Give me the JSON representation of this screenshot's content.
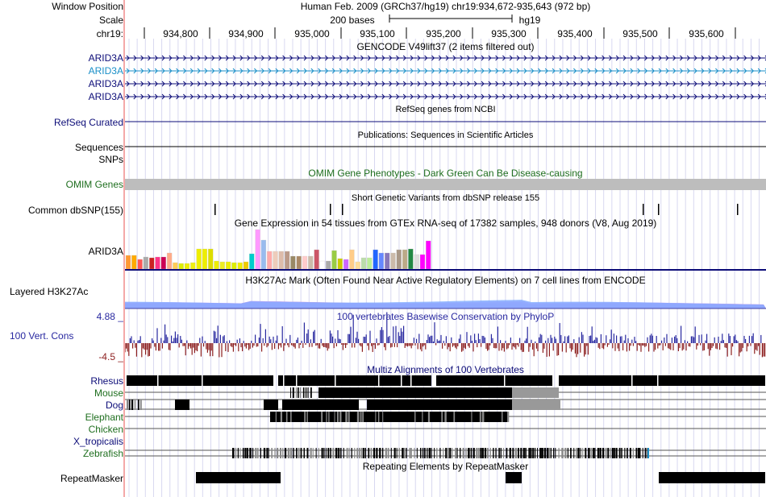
{
  "header": {
    "window_position_label": "Window Position",
    "window_position_value": "Human Feb. 2009 (GRCh37/hg19)   chr19:934,672-935,643 (972 bp)",
    "scale_label": "Scale",
    "scale_bar_text": "200 bases",
    "scale_assembly": "hg19",
    "chrom_label": "chr19:",
    "ruler_ticks": [
      "934,800",
      "934,900",
      "935,000",
      "935,100",
      "935,200",
      "935,300",
      "935,400",
      "935,500",
      "935,600"
    ]
  },
  "tracks": {
    "gencode": {
      "title": "GENCODE V49lift37 (2 items filtered out)",
      "items": [
        "ARID3A",
        "ARID3A",
        "ARID3A",
        "ARID3A"
      ],
      "color_primary": "#0c0c78",
      "color_secondary": "#1a8fc8"
    },
    "refseq": {
      "title": "RefSeq genes from NCBI",
      "label": "RefSeq Curated",
      "color": "#0c0c78"
    },
    "publications": {
      "title": "Publications: Sequences in Scientific Articles",
      "label": "Sequences"
    },
    "snps": {
      "label": "SNPs"
    },
    "omim": {
      "title": "OMIM Gene Phenotypes - Dark Green Can Be Disease-causing",
      "label": "OMIM Genes",
      "color": "#1e6e1e"
    },
    "dbsnp": {
      "title": "Short Genetic Variants from dbSNP release 155",
      "label": "Common dbSNP(155)"
    },
    "gtex": {
      "title": "Gene Expression in 54 tissues from GTEx RNA-seq of 17382 samples, 948 donors (V8, Aug 2019)",
      "label": "ARID3A",
      "values": [
        17,
        17,
        12,
        15,
        14,
        15,
        15,
        20,
        8,
        7,
        7,
        8,
        25,
        25,
        25,
        10,
        9,
        9,
        8,
        8,
        9,
        19,
        49,
        36,
        22,
        22,
        22,
        22,
        16,
        16,
        16,
        16,
        24,
        10,
        10,
        23,
        13,
        12,
        24,
        9,
        14,
        14,
        24,
        20,
        20,
        20,
        24,
        24,
        25,
        18,
        18,
        35
      ],
      "colors": [
        "#ff9933",
        "#ffaa00",
        "#ff5555",
        "#aaaaaa",
        "#cc2222",
        "#ff3388",
        "#cc0055",
        "#ffaa88",
        "#ffcc55",
        "#ddee00",
        "#eeee00",
        "#eeee11",
        "#eeee00",
        "#eeee00",
        "#dddd00",
        "#eeee00",
        "#eeee22",
        "#eeee00",
        "#ddee00",
        "#eeee00",
        "#eecc00",
        "#00cccc",
        "#ff99ff",
        "#99bbee",
        "#ffaaaa",
        "#eeccbb",
        "#ddbbaa",
        "#bb9988",
        "#998866",
        "#aa8866",
        "#ffcccc",
        "#ccbbaa",
        "#cc5566",
        "#ffffff",
        "#aaaaaa",
        "#99cc44",
        "#cccc00",
        "#cc66ff",
        "#ffcc88",
        "#ffdd99",
        "#bbddaa",
        "#bbee99",
        "#2266ff",
        "#6688ff",
        "#8877bb",
        "#ccbbaa",
        "#aa9988",
        "#bbaa88",
        "#228844",
        "#dddddd",
        "#ff00ff",
        "#ff00ff"
      ]
    },
    "h3k27ac": {
      "title": "H3K27Ac Mark (Often Found Near Active Regulatory Elements) on 7 cell lines from ENCODE",
      "label": "Layered H3K27Ac"
    },
    "cons": {
      "title": "100 vertebrates Basewise Conservation by PhyloP",
      "label": "100 Vert. Cons",
      "max": "4.88 _",
      "min": "-4.5 _",
      "pos_color": "#2828a0",
      "neg_color": "#8c1e1e"
    },
    "multiz": {
      "title": "Multiz Alignments of 100 Vertebrates",
      "species": [
        {
          "name": "Rhesus",
          "color": "#0c0c78"
        },
        {
          "name": "Mouse",
          "color": "#1e6e1e"
        },
        {
          "name": "Dog",
          "color": "#0c0c78"
        },
        {
          "name": "Elephant",
          "color": "#1e6e1e"
        },
        {
          "name": "Chicken",
          "color": "#1e6e1e"
        },
        {
          "name": "X_tropicalis",
          "color": "#0c0c78"
        },
        {
          "name": "Zebrafish",
          "color": "#1e6e1e"
        }
      ]
    },
    "repeatmasker": {
      "title": "Repeating Elements by RepeatMasker",
      "label": "RepeatMasker"
    }
  }
}
